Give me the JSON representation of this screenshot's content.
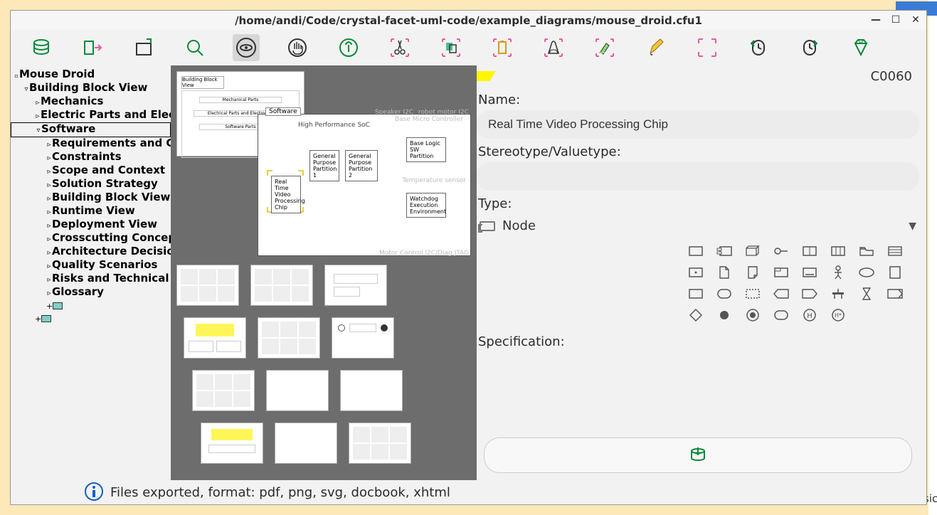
{
  "window": {
    "title": "/home/andi/Code/crystal-facet-uml-code/example_diagrams/mouse_droid.cfu1"
  },
  "tree": {
    "root": "Mouse Droid",
    "l1": "Building Block View",
    "children": [
      "Mechanics",
      "Electric Parts and Electronics",
      "Software"
    ],
    "software_children": [
      "Requirements and Goals",
      "Constraints",
      "Scope and Context",
      "Solution Strategy",
      "Building Block View",
      "Runtime View",
      "Deployment View",
      "Crosscutting Concepts",
      "Architecture Decisions",
      "Quality Scenarios",
      "Risks and Technical Debts",
      "Glossary"
    ]
  },
  "diagram": {
    "tab_label": "Software",
    "subtitle": "High Performance SoC",
    "top_right_1": "Speaker I2C",
    "top_right_2": "robot motor I2C",
    "top_right_3": "Base Micro Controller",
    "bottom_right": "Motor Control I2C/Diag JTAG",
    "label_temp": "Temperature sensor",
    "nodes": {
      "rtvpc": "Real Time\nVideo\nProcessing\nChip",
      "gpp1": "General\nPurpose\nPartition 1",
      "gpp2": "General\nPurpose\nPartition 2",
      "blsw": "Base Logic SW\nPartition",
      "wde": "Watchdog\nExecution\nEnvironment"
    },
    "stack_labels": {
      "title": "Building Block View",
      "mid1": "Mechanical Parts",
      "mid2": "Electrical Parts and Electronics",
      "mid3": "Software Parts"
    }
  },
  "panel": {
    "id": "C0060",
    "name_lbl": "Name:",
    "name_val": "Real Time Video Processing Chip",
    "stereo_lbl": "Stereotype/Valuetype:",
    "stereo_val": "",
    "type_lbl": "Type:",
    "type_val": "Node",
    "spec_lbl": "Specification:"
  },
  "status": {
    "msg": "Files exported, format: pdf, png, svg, docbook, xhtml"
  },
  "bg": {
    "basic": "Basic,"
  }
}
